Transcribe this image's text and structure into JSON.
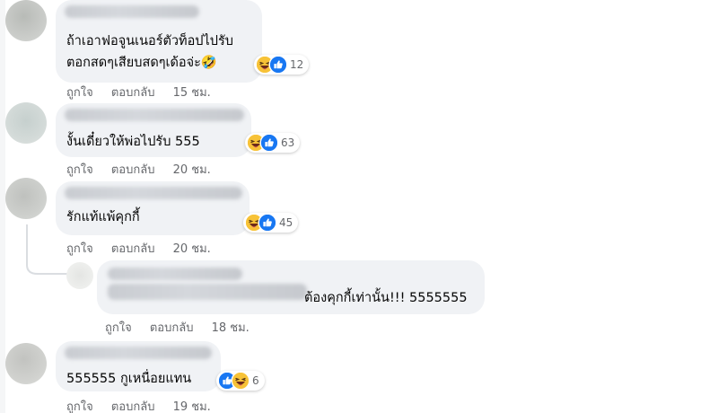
{
  "actions": {
    "like": "ถูกใจ",
    "reply": "ตอบกลับ"
  },
  "comments": [
    {
      "text_lines": [
        "ถ้าเอาฟอจูนเนอร์ตัวท็อปไปรับ",
        "ตอกสดๆเสียบสดๆเด้อจ่ะ🤣"
      ],
      "reactions": [
        "haha",
        "like"
      ],
      "reaction_count": "12",
      "time": "15 ชม."
    },
    {
      "text_lines": [
        "งั้นเดี๋ยวให้พ่อไปรับ 555"
      ],
      "reactions": [
        "haha",
        "like"
      ],
      "reaction_count": "63",
      "time": "20 ชม."
    },
    {
      "text_lines": [
        "รักแท้แพ้คุกกี้"
      ],
      "reactions": [
        "haha",
        "like"
      ],
      "reaction_count": "45",
      "time": "20 ชม."
    },
    {
      "text_lines": [
        "ต้องคุกกี้เท่านั้น!!! 5555555"
      ],
      "reactions": [],
      "reaction_count": "",
      "time": "18 ชม."
    },
    {
      "text_lines": [
        "555555 กูเหนื่อยแทน"
      ],
      "reactions": [
        "like",
        "haha"
      ],
      "reaction_count": "6",
      "time": "19 ชม."
    }
  ],
  "colors": {
    "bubble": "#f0f2f5",
    "text": "#050505",
    "meta": "#65676b",
    "like_blue": "#1877f2",
    "haha_yellow": "#f7c237"
  }
}
